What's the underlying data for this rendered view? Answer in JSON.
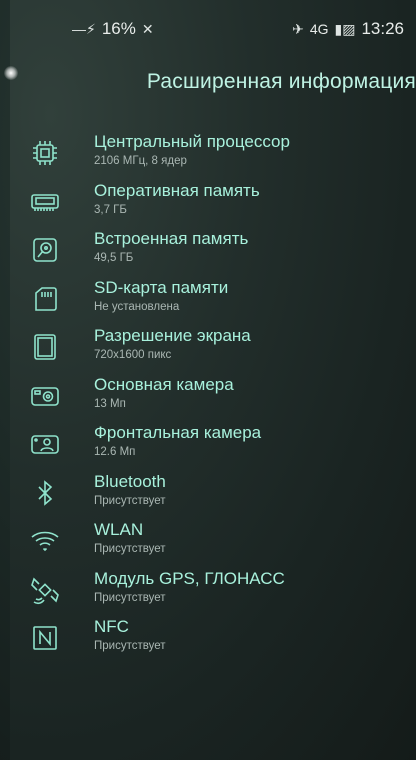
{
  "status": {
    "battery": "16%",
    "network": "4G",
    "time": "13:26"
  },
  "header": {
    "title": "Расширенная информация"
  },
  "colors": {
    "accent": "#a8f1dc",
    "subtitle": "#aab7b3",
    "icon": "#8fe3cc"
  },
  "items": [
    {
      "icon": "cpu-chip-icon",
      "title": "Центральный процессор",
      "value": "2106 МГц, 8 ядер"
    },
    {
      "icon": "ram-module-icon",
      "title": "Оперативная память",
      "value": "3,7 ГБ"
    },
    {
      "icon": "internal-storage-icon",
      "title": "Встроенная память",
      "value": "49,5 ГБ"
    },
    {
      "icon": "sd-card-icon",
      "title": "SD-карта памяти",
      "value": "Не установлена"
    },
    {
      "icon": "screen-icon",
      "title": "Разрешение экрана",
      "value": "720x1600 пикс"
    },
    {
      "icon": "rear-camera-icon",
      "title": "Основная камера",
      "value": "13 Мп"
    },
    {
      "icon": "front-camera-icon",
      "title": "Фронтальная камера",
      "value": "12.6 Мп"
    },
    {
      "icon": "bluetooth-icon",
      "title": "Bluetooth",
      "value": "Присутствует"
    },
    {
      "icon": "wifi-icon",
      "title": "WLAN",
      "value": "Присутствует"
    },
    {
      "icon": "satellite-icon",
      "title": "Модуль GPS, ГЛОНАСС",
      "value": "Присутствует"
    },
    {
      "icon": "nfc-icon",
      "title": "NFC",
      "value": "Присутствует"
    }
  ]
}
